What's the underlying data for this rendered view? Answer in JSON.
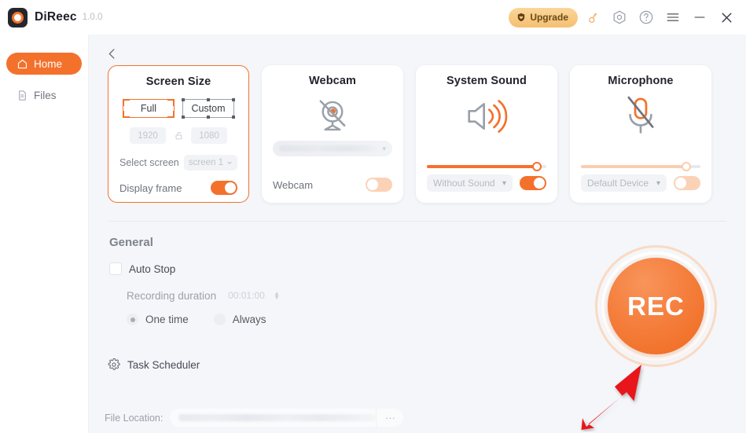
{
  "titlebar": {
    "app_name": "DiReec",
    "version": "1.0.0",
    "upgrade_label": "Upgrade",
    "icons": [
      "shield-heart-icon",
      "key-icon",
      "settings-hex-icon",
      "help-icon",
      "menu-icon",
      "minimize-icon",
      "close-icon"
    ],
    "accent": "#f4712c",
    "upgrade_gold": "#f7c983"
  },
  "sidebar": {
    "items": [
      {
        "label": "Home",
        "icon": "home-icon",
        "active": true
      },
      {
        "label": "Files",
        "icon": "file-icon",
        "active": false
      }
    ]
  },
  "content": {
    "back_icon": "back-arrow-icon"
  },
  "cards": {
    "screen_size": {
      "title": "Screen Size",
      "mode_full": "Full",
      "mode_custom": "Custom",
      "selected_mode": "Full",
      "width_value": "1920",
      "height_value": "1080",
      "lock_icon": "unlock-icon",
      "select_screen_label": "Select screen",
      "screen_value": "screen 1",
      "display_frame_label": "Display frame",
      "display_frame_on": true
    },
    "webcam": {
      "title": "Webcam",
      "icon": "webcam-disabled-icon",
      "device_value": "",
      "foot_label": "Webcam",
      "toggle_on": false
    },
    "system_sound": {
      "title": "System Sound",
      "icon": "speaker-icon",
      "volume_percent": 92,
      "device_value": "Without Sound",
      "toggle_on": true
    },
    "microphone": {
      "title": "Microphone",
      "icon": "microphone-muted-icon",
      "volume_percent": 88,
      "device_value": "Default Device",
      "toggle_on": false
    }
  },
  "general": {
    "title": "General",
    "auto_stop_label": "Auto Stop",
    "auto_stop_checked": false,
    "duration_label": "Recording duration",
    "duration_value": "00:01:00",
    "radio_one_time": "One time",
    "radio_always": "Always",
    "radio_selected": "One time",
    "task_scheduler_label": "Task Scheduler",
    "task_scheduler_icon": "gear-icon"
  },
  "file_location": {
    "label": "File Location:",
    "path_value": "",
    "browse_label": "···"
  },
  "record": {
    "label": "REC",
    "color": "#f4712c",
    "annotation_arrow_color": "#e8191a"
  }
}
